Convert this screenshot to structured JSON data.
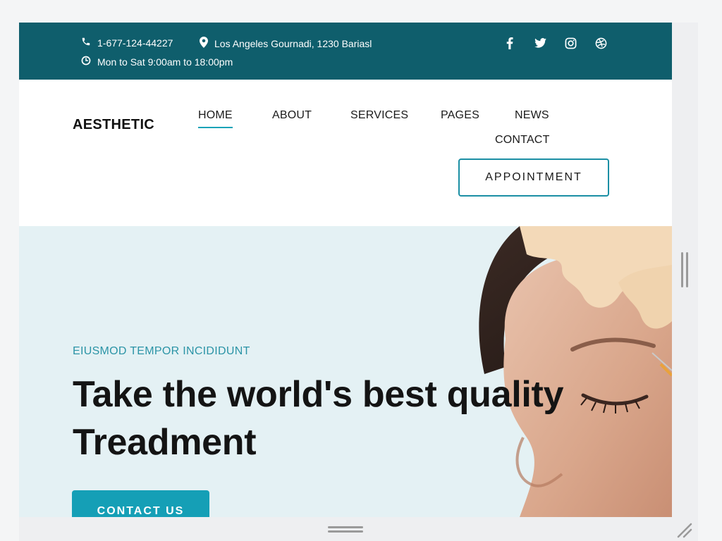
{
  "topbar": {
    "phone": "1-677-124-44227",
    "location": "Los Angeles Gournadi, 1230 Bariasl",
    "hours": "Mon to Sat 9:00am to 18:00pm",
    "icons": [
      "phone-icon",
      "map-pin-icon",
      "clock-icon"
    ],
    "socials": [
      "facebook-icon",
      "twitter-icon",
      "instagram-icon",
      "dribbble-icon"
    ]
  },
  "header": {
    "logo": "AESTHETIC",
    "nav": [
      "HOME",
      "ABOUT",
      "SERVICES",
      "PAGES",
      "NEWS",
      "CONTACT"
    ],
    "active_nav": "HOME",
    "appointment_label": "APPOINTMENT"
  },
  "hero": {
    "eyebrow": "EIUSMOD TEMPOR INCIDIDUNT",
    "headline_line1": "Take the world's best quality",
    "headline_line2": "Treadment",
    "cta_label": "CONTACT US"
  },
  "colors": {
    "topbar": "#0f5e6c",
    "accent": "#159fb6",
    "hero_bg": "#e4f1f4",
    "text_dark": "#141414"
  }
}
